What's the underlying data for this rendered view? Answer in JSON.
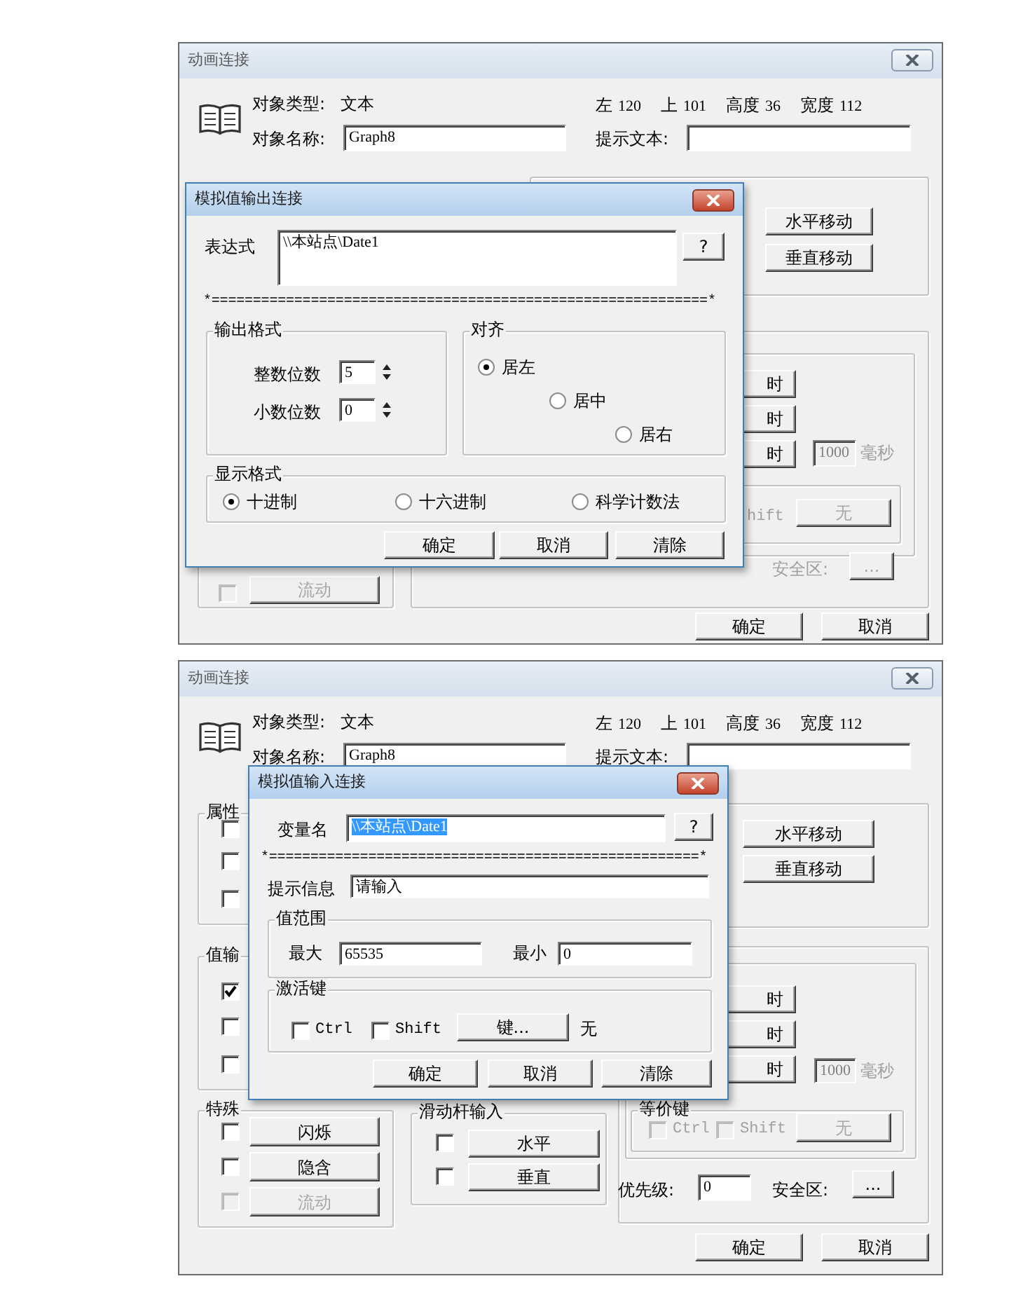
{
  "dialogs": [
    {
      "title": "动画连接",
      "header": {
        "type_label": "对象类型:",
        "type_value": "文本",
        "name_label": "对象名称:",
        "name_value": "Graph8",
        "hint_label": "提示文本:",
        "geometry": [
          {
            "label": "左",
            "value": "120"
          },
          {
            "label": "上",
            "value": "101"
          },
          {
            "label": "高度",
            "value": "36"
          },
          {
            "label": "宽度",
            "value": "112"
          }
        ]
      },
      "controls": [
        {
          "kind": "button",
          "text": "水平移动",
          "disabled": false
        },
        {
          "kind": "button",
          "text": "垂直移动",
          "disabled": false
        },
        {
          "kind": "button",
          "text": "时",
          "disabled": false
        },
        {
          "kind": "button",
          "text": "时",
          "disabled": false
        },
        {
          "kind": "button",
          "text": "时",
          "disabled": false
        },
        {
          "kind": "field",
          "value": "1000",
          "disabled": true
        },
        {
          "kind": "label",
          "text": "毫秒",
          "disabled": true
        },
        {
          "kind": "label",
          "text": "hift",
          "disabled": true
        },
        {
          "kind": "button",
          "text": "无",
          "disabled": true
        },
        {
          "kind": "label",
          "text": "安全区:",
          "disabled": true
        },
        {
          "kind": "button",
          "text": "...",
          "disabled": true
        },
        {
          "kind": "checkbox",
          "checked": false,
          "disabled": true
        },
        {
          "kind": "button",
          "text": "流动",
          "disabled": true
        },
        {
          "kind": "button",
          "text": "确定",
          "disabled": false
        },
        {
          "kind": "button",
          "text": "取消",
          "disabled": false
        }
      ],
      "popup": {
        "title": "模拟值输出连接",
        "controls": [
          {
            "kind": "label",
            "text": "表达式"
          },
          {
            "kind": "textarea",
            "value": "\\\\本站点\\Date1",
            "selected": false
          },
          {
            "kind": "button",
            "text": "?"
          },
          {
            "kind": "separator",
            "text": "*============================================================*"
          },
          {
            "kind": "group",
            "label": "输出格式"
          },
          {
            "kind": "label",
            "text": "整数位数"
          },
          {
            "kind": "spin",
            "value": "5"
          },
          {
            "kind": "label",
            "text": "小数位数"
          },
          {
            "kind": "spin",
            "value": "0"
          },
          {
            "kind": "group",
            "label": "对齐"
          },
          {
            "kind": "radio",
            "text": "居左",
            "selected": true
          },
          {
            "kind": "radio",
            "text": "居中",
            "selected": false
          },
          {
            "kind": "radio",
            "text": "居右",
            "selected": false
          },
          {
            "kind": "group",
            "label": "显示格式"
          },
          {
            "kind": "radio",
            "text": "十进制",
            "selected": true
          },
          {
            "kind": "radio",
            "text": "十六进制",
            "selected": false
          },
          {
            "kind": "radio",
            "text": "科学计数法",
            "selected": false
          },
          {
            "kind": "button",
            "text": "确定"
          },
          {
            "kind": "button",
            "text": "取消"
          },
          {
            "kind": "button",
            "text": "清除"
          }
        ]
      }
    },
    {
      "title": "动画连接",
      "header": {
        "type_label": "对象类型:",
        "type_value": "文本",
        "name_label": "对象名称:",
        "name_value": "Graph8",
        "hint_label": "提示文本:",
        "geometry": [
          {
            "label": "左",
            "value": "120"
          },
          {
            "label": "上",
            "value": "101"
          },
          {
            "label": "高度",
            "value": "36"
          },
          {
            "label": "宽度",
            "value": "112"
          }
        ]
      },
      "controls": [
        {
          "kind": "group",
          "label": "属性"
        },
        {
          "kind": "checkbox",
          "checked": false,
          "disabled": false
        },
        {
          "kind": "checkbox",
          "checked": false,
          "disabled": false
        },
        {
          "kind": "checkbox",
          "checked": false,
          "disabled": false
        },
        {
          "kind": "group",
          "label": "值输"
        },
        {
          "kind": "checkbox",
          "checked": true,
          "disabled": false
        },
        {
          "kind": "checkbox",
          "checked": false,
          "disabled": false
        },
        {
          "kind": "checkbox",
          "checked": false,
          "disabled": false
        },
        {
          "kind": "group",
          "label": "特殊"
        },
        {
          "kind": "checkbox",
          "checked": false,
          "disabled": false
        },
        {
          "kind": "button",
          "text": "闪烁",
          "disabled": false
        },
        {
          "kind": "checkbox",
          "checked": false,
          "disabled": false
        },
        {
          "kind": "button",
          "text": "隐含",
          "disabled": false
        },
        {
          "kind": "checkbox",
          "checked": false,
          "disabled": true
        },
        {
          "kind": "button",
          "text": "流动",
          "disabled": true
        },
        {
          "kind": "group",
          "label": "滑动杆输入"
        },
        {
          "kind": "checkbox",
          "checked": false,
          "disabled": false
        },
        {
          "kind": "button",
          "text": "水平",
          "disabled": false
        },
        {
          "kind": "checkbox",
          "checked": false,
          "disabled": false
        },
        {
          "kind": "button",
          "text": "垂直",
          "disabled": false
        },
        {
          "kind": "button",
          "text": "水平移动",
          "disabled": false
        },
        {
          "kind": "button",
          "text": "垂直移动",
          "disabled": false
        },
        {
          "kind": "button",
          "text": "时",
          "disabled": false
        },
        {
          "kind": "button",
          "text": "时",
          "disabled": false
        },
        {
          "kind": "button",
          "text": "时",
          "disabled": false
        },
        {
          "kind": "field",
          "value": "1000",
          "disabled": true
        },
        {
          "kind": "label",
          "text": "毫秒",
          "disabled": true
        },
        {
          "kind": "group",
          "label": "等价键"
        },
        {
          "kind": "checkbox",
          "text": "Ctrl",
          "checked": false,
          "disabled": true
        },
        {
          "kind": "checkbox",
          "text": "Shift",
          "checked": false,
          "disabled": true
        },
        {
          "kind": "button",
          "text": "无",
          "disabled": true
        },
        {
          "kind": "label",
          "text": "优先级:",
          "disabled": false
        },
        {
          "kind": "field",
          "value": "0",
          "disabled": false
        },
        {
          "kind": "label",
          "text": "安全区:",
          "disabled": false
        },
        {
          "kind": "button",
          "text": "...",
          "disabled": false
        },
        {
          "kind": "button",
          "text": "确定",
          "disabled": false
        },
        {
          "kind": "button",
          "text": "取消",
          "disabled": false
        }
      ],
      "popup": {
        "title": "模拟值输入连接",
        "controls": [
          {
            "kind": "label",
            "text": "变量名"
          },
          {
            "kind": "field",
            "value": "\\\\本站点\\Date1",
            "selected": true
          },
          {
            "kind": "button",
            "text": "?"
          },
          {
            "kind": "separator",
            "text": "*====================================================*"
          },
          {
            "kind": "label",
            "text": "提示信息"
          },
          {
            "kind": "field",
            "value": "请输入",
            "selected": false
          },
          {
            "kind": "group",
            "label": "值范围"
          },
          {
            "kind": "label",
            "text": "最大"
          },
          {
            "kind": "field",
            "value": "65535",
            "selected": false
          },
          {
            "kind": "label",
            "text": "最小"
          },
          {
            "kind": "field",
            "value": "0",
            "selected": false
          },
          {
            "kind": "group",
            "label": "激活键"
          },
          {
            "kind": "checkbox",
            "text": "Ctrl",
            "checked": false
          },
          {
            "kind": "checkbox",
            "text": "Shift",
            "checked": false
          },
          {
            "kind": "button",
            "text": "键..."
          },
          {
            "kind": "label",
            "text": "无"
          },
          {
            "kind": "button",
            "text": "确定"
          },
          {
            "kind": "button",
            "text": "取消"
          },
          {
            "kind": "button",
            "text": "清除"
          }
        ]
      }
    }
  ]
}
